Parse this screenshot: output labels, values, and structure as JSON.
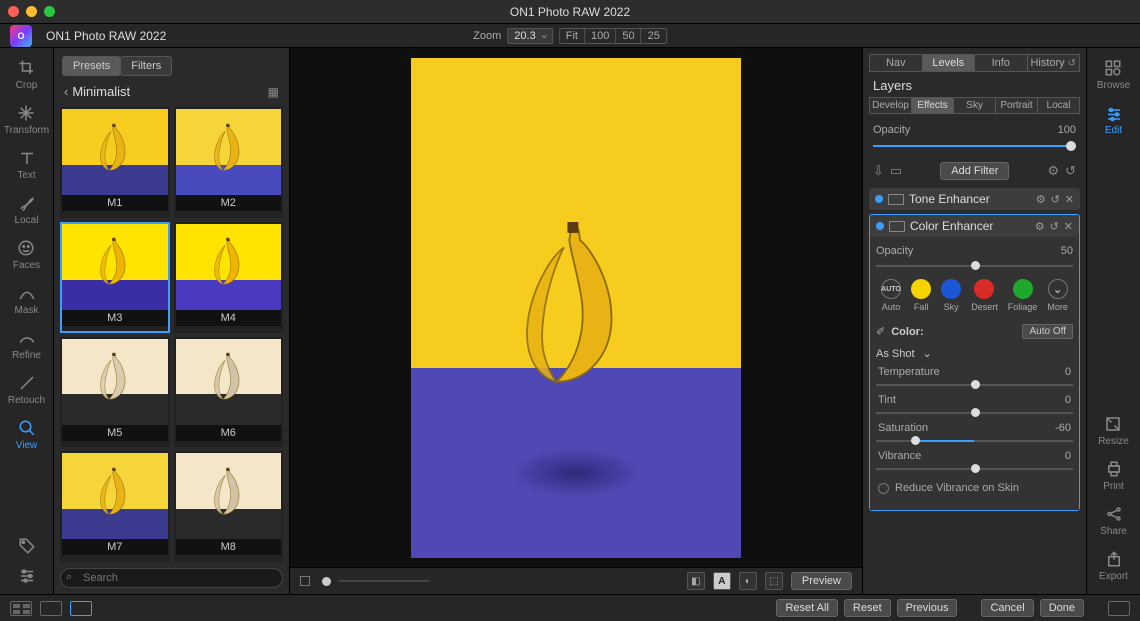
{
  "titlebar": {
    "title": "ON1 Photo RAW 2022"
  },
  "toolbar": {
    "app_name": "ON1 Photo RAW 2022",
    "zoom_label": "Zoom",
    "zoom_value": "20.3",
    "zoom_presets": [
      "Fit",
      "100",
      "50",
      "25"
    ]
  },
  "left_rail": {
    "tools": [
      {
        "name": "crop",
        "label": "Crop"
      },
      {
        "name": "transform",
        "label": "Transform"
      },
      {
        "name": "text",
        "label": "Text"
      },
      {
        "name": "local",
        "label": "Local"
      },
      {
        "name": "faces",
        "label": "Faces"
      },
      {
        "name": "mask",
        "label": "Mask"
      },
      {
        "name": "refine",
        "label": "Refine"
      },
      {
        "name": "retouch",
        "label": "Retouch"
      },
      {
        "name": "view",
        "label": "View"
      }
    ]
  },
  "presets_panel": {
    "tabs": [
      "Presets",
      "Filters"
    ],
    "category": "Minimalist",
    "items": [
      {
        "label": "M1",
        "top": "#f6cd1e",
        "bot": "#3a3a8f",
        "banana": "#e9b215"
      },
      {
        "label": "M2",
        "top": "#f6d53a",
        "bot": "#4a4abf",
        "banana": "#e9b215"
      },
      {
        "label": "M3",
        "top": "#ffe400",
        "bot": "#3a2ea6",
        "banana": "#f0b400"
      },
      {
        "label": "M4",
        "top": "#ffe400",
        "bot": "#4a3abf",
        "banana": "#f0b400"
      },
      {
        "label": "M5",
        "top": "#f3e6c9",
        "bot": "#2a2a2a",
        "banana": "#d9cbb0"
      },
      {
        "label": "M6",
        "top": "#f3e6c9",
        "bot": "#2a2a2a",
        "banana": "#d0c3a8"
      },
      {
        "label": "M7",
        "top": "#f6d53a",
        "bot": "#3a3a8f",
        "banana": "#e9b215"
      },
      {
        "label": "M8",
        "top": "#f3e6c9",
        "bot": "#2a2a2a",
        "banana": "#d0c3a8"
      }
    ],
    "selected_index": 2,
    "search_placeholder": "Search"
  },
  "canvas": {
    "preview_label": "Preview"
  },
  "right_panel": {
    "tabs": [
      "Nav",
      "Levels",
      "Info",
      "History"
    ],
    "active_tab": "Levels",
    "layers_label": "Layers",
    "mode_tabs": [
      "Develop",
      "Effects",
      "Sky",
      "Portrait",
      "Local"
    ],
    "active_mode": "Effects",
    "opacity_label": "Opacity",
    "opacity_value": "100",
    "add_filter_label": "Add Filter",
    "filters": [
      {
        "name": "Tone Enhancer"
      },
      {
        "name": "Color Enhancer"
      }
    ],
    "color_enhancer": {
      "opacity_label": "Opacity",
      "opacity_value": "50",
      "swatches": [
        {
          "label": "Auto",
          "css": "#fff",
          "kind": "auto"
        },
        {
          "label": "Fall",
          "css": "#f5d400"
        },
        {
          "label": "Sky",
          "css": "#1a56d6"
        },
        {
          "label": "Desert",
          "css": "#d92a2a"
        },
        {
          "label": "Foliage",
          "css": "#1fa82e"
        },
        {
          "label": "More",
          "css": "#222",
          "kind": "more"
        }
      ],
      "color_head": "Color:",
      "auto_off": "Auto Off",
      "dropdown": "As Shot",
      "params": [
        {
          "label": "Temperature",
          "value": "0",
          "pos": 50
        },
        {
          "label": "Tint",
          "value": "0",
          "pos": 50
        },
        {
          "label": "Saturation",
          "value": "-60",
          "pos": 20
        },
        {
          "label": "Vibrance",
          "value": "0",
          "pos": 50
        }
      ],
      "checkbox": "Reduce Vibrance on Skin"
    }
  },
  "right_rail": {
    "items": [
      {
        "name": "browse",
        "label": "Browse"
      },
      {
        "name": "edit",
        "label": "Edit"
      },
      {
        "name": "resize",
        "label": "Resize"
      },
      {
        "name": "print",
        "label": "Print"
      },
      {
        "name": "share",
        "label": "Share"
      },
      {
        "name": "export",
        "label": "Export"
      }
    ]
  },
  "footer": {
    "buttons": [
      "Reset All",
      "Reset",
      "Previous",
      "Cancel",
      "Done"
    ]
  }
}
